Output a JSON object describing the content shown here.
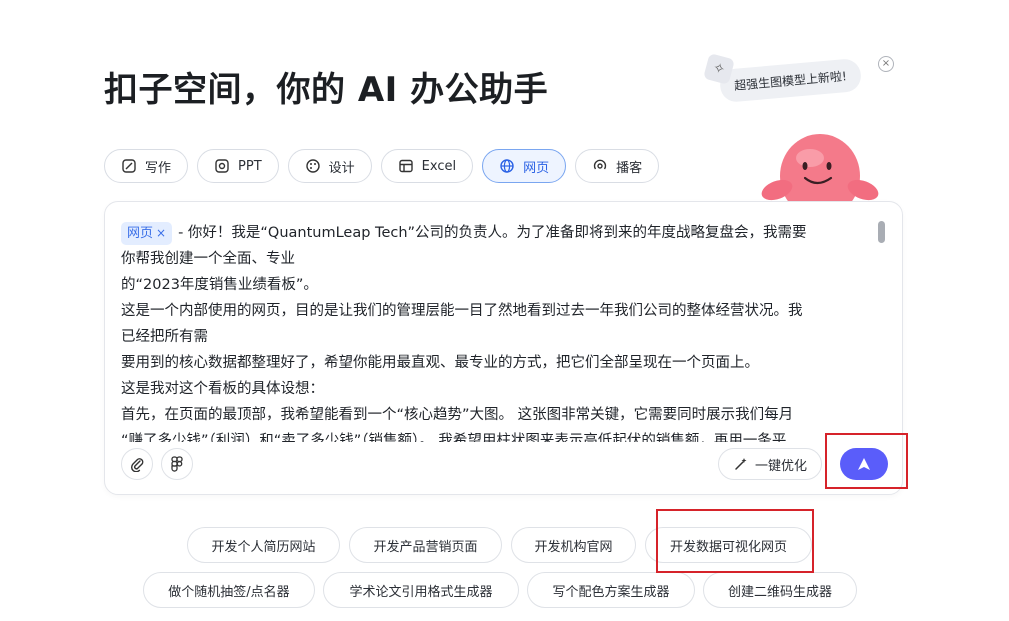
{
  "header": {
    "title": "扣子空间，你的 AI 办公助手"
  },
  "tabs": [
    {
      "label": "写作",
      "icon": "write-icon"
    },
    {
      "label": "PPT",
      "icon": "ppt-icon"
    },
    {
      "label": "设计",
      "icon": "palette-icon"
    },
    {
      "label": "Excel",
      "icon": "table-icon"
    },
    {
      "label": "网页",
      "icon": "globe-icon",
      "active": true
    },
    {
      "label": "播客",
      "icon": "podcast-icon"
    }
  ],
  "promo": {
    "text": "超强生图模型上新啦!",
    "close": "×",
    "mascot": "pink-mascot"
  },
  "composer": {
    "chip_label": "网页",
    "chip_close": "×",
    "lines": [
      "- 你好！我是“QuantumLeap Tech”公司的负责人。为了准备即将到来的年度战略复盘会，我需要",
      "你帮我创建一个全面、专业",
      "的“2023年度销售业绩看板”。",
      "这是一个内部使用的网页，目的是让我们的管理层能一目了然地看到过去一年我们公司的整体经营状况。我",
      "已经把所有需",
      "要用到的核心数据都整理好了，希望你能用最直观、最专业的方式，把它们全部呈现在一个页面上。",
      "这是我对这个看板的具体设想：",
      "首先，在页面的最顶部，我希望能看到一个“核心趋势”大图。 这张图非常关键，它需要同时展示我们每月",
      "“赚了多少钱”（利润）和“卖了多少钱”（销售额）。 我希望用柱状图来表示高低起伏的销售额，再用一条平"
    ],
    "optimize_label": "一键优化",
    "attach_icon": "paperclip-icon",
    "figma_icon": "figma-icon",
    "send_icon": "send-arrow-icon"
  },
  "suggestions": [
    "开发个人简历网站",
    "开发产品营销页面",
    "开发机构官网",
    "开发数据可视化网页",
    "做个随机抽签/点名器",
    "学术论文引用格式生成器",
    "写个配色方案生成器",
    "创建二维码生成器"
  ],
  "colors": {
    "accent": "#5a5dfa",
    "highlight": "#d6232a",
    "chip_bg": "#e3edff",
    "active_tab": "#2b62e5"
  }
}
